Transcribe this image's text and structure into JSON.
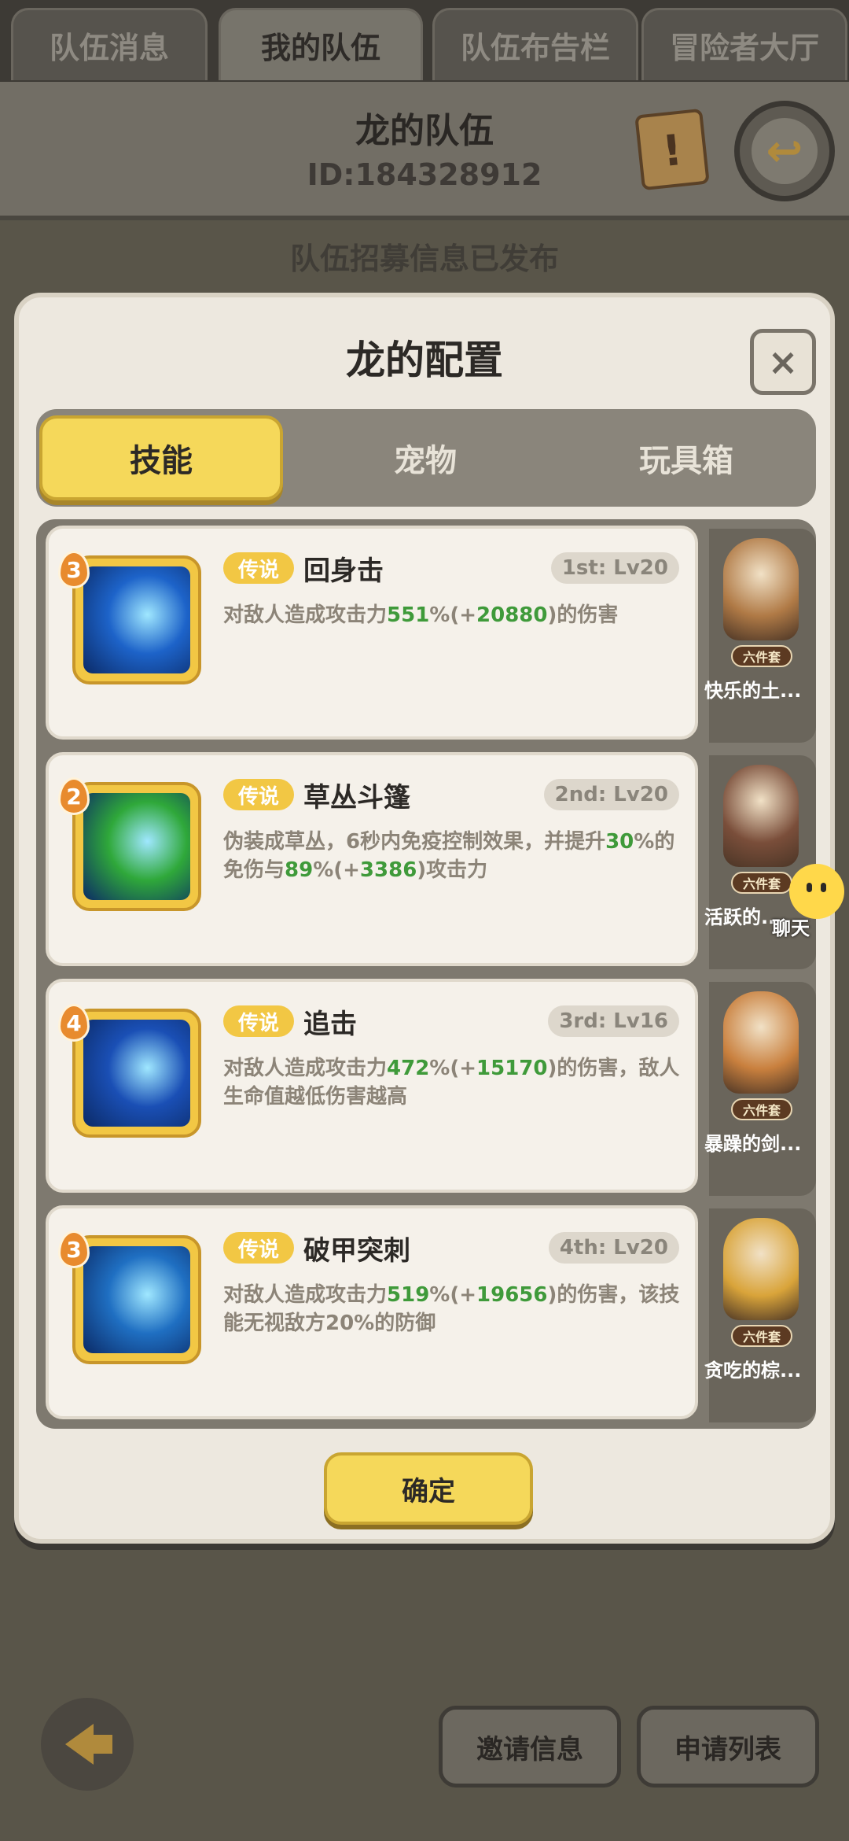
{
  "top_tabs": [
    "队伍消息",
    "我的队伍",
    "队伍布告栏",
    "冒险者大厅"
  ],
  "team": {
    "name": "龙的队伍",
    "id_label": "ID:184328912"
  },
  "recruit_status": "队伍招募信息已发布",
  "dialog": {
    "title": "龙的配置",
    "close": "×",
    "sub_tabs": [
      "技能",
      "宠物",
      "玩具箱"
    ],
    "confirm_label": "确定"
  },
  "skills": [
    {
      "rank": "3",
      "rarity": "传说",
      "name": "回身击",
      "slot": "1st: Lv20",
      "desc": [
        [
          "对敌人造成攻击力",
          ""
        ],
        [
          "551",
          "g"
        ],
        [
          "%(+",
          ""
        ],
        [
          "20880",
          "g"
        ],
        [
          ")的伤害",
          ""
        ]
      ]
    },
    {
      "rank": "2",
      "rarity": "传说",
      "name": "草丛斗篷",
      "slot": "2nd: Lv20",
      "desc": [
        [
          "伪装成草丛，6秒内免疫控制效果，并提升",
          ""
        ],
        [
          "30",
          "g"
        ],
        [
          "%的免伤与",
          ""
        ],
        [
          "89",
          "g"
        ],
        [
          "%(+",
          ""
        ],
        [
          "3386",
          "g"
        ],
        [
          ")攻击力",
          ""
        ]
      ]
    },
    {
      "rank": "4",
      "rarity": "传说",
      "name": "追击",
      "slot": "3rd: Lv16",
      "desc": [
        [
          "对敌人造成攻击力",
          ""
        ],
        [
          "472",
          "g"
        ],
        [
          "%(+",
          ""
        ],
        [
          "15170",
          "g"
        ],
        [
          ")的伤害，敌人生命值越低伤害越高",
          ""
        ]
      ]
    },
    {
      "rank": "3",
      "rarity": "传说",
      "name": "破甲突刺",
      "slot": "4th: Lv20",
      "desc": [
        [
          "对敌人造成攻击力",
          ""
        ],
        [
          "519",
          "g"
        ],
        [
          "%(+",
          ""
        ],
        [
          "19656",
          "g"
        ],
        [
          ")的伤害，该技能无视敌方20%的防御",
          ""
        ]
      ]
    }
  ],
  "pets": [
    {
      "name": "快乐的土...",
      "set_tag": "六件套",
      "color": "#b07a46"
    },
    {
      "name": "活跃的...",
      "set_tag": "六件套",
      "color": "#7a4e3a"
    },
    {
      "name": "暴躁的剑...",
      "set_tag": "六件套",
      "color": "#c9803e"
    },
    {
      "name": "贪吃的棕...",
      "set_tag": "六件套",
      "color": "#d9a43a"
    }
  ],
  "skill_icon_colors": [
    "#1d63c9",
    "#2fa83a",
    "#1a4fb5",
    "#1f6fc2"
  ],
  "chat": {
    "label": "聊天"
  },
  "bottom": {
    "invite": "邀请信息",
    "applications": "申请列表"
  }
}
